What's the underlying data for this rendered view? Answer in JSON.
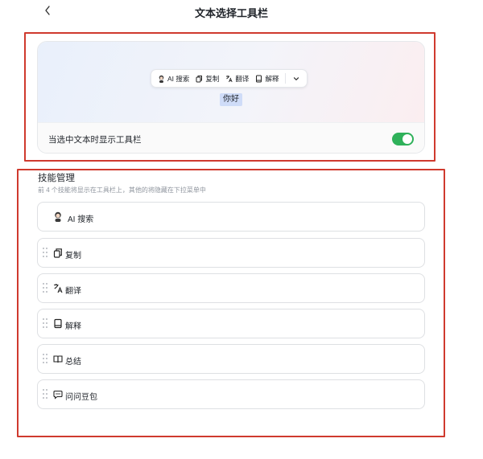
{
  "header": {
    "back_icon": "chevron-left-icon",
    "title": "文本选择工具栏"
  },
  "preview": {
    "toolbar_items": [
      {
        "label": "AI 搜索",
        "icon": "ai-avatar-icon"
      },
      {
        "label": "复制",
        "icon": "copy-icon"
      },
      {
        "label": "翻译",
        "icon": "translate-icon"
      },
      {
        "label": "解释",
        "icon": "book-icon"
      }
    ],
    "more_icon": "chevron-down-icon",
    "selected_text": "你好"
  },
  "setting": {
    "label": "当选中文本时显示工具栏",
    "enabled": true,
    "accent_color": "#2fb15a"
  },
  "skills": {
    "title": "技能管理",
    "description": "前 4 个技能将显示在工具栏上，其他的将隐藏在下拉菜单中",
    "items": [
      {
        "label": "AI 搜索",
        "icon": "ai-avatar-icon",
        "draggable": false
      },
      {
        "label": "复制",
        "icon": "copy-icon",
        "draggable": true
      },
      {
        "label": "翻译",
        "icon": "translate-icon",
        "draggable": true
      },
      {
        "label": "解释",
        "icon": "book-icon",
        "draggable": true
      },
      {
        "label": "总结",
        "icon": "open-book-icon",
        "draggable": true
      },
      {
        "label": "问问豆包",
        "icon": "chat-bubble-icon",
        "draggable": true
      }
    ]
  }
}
